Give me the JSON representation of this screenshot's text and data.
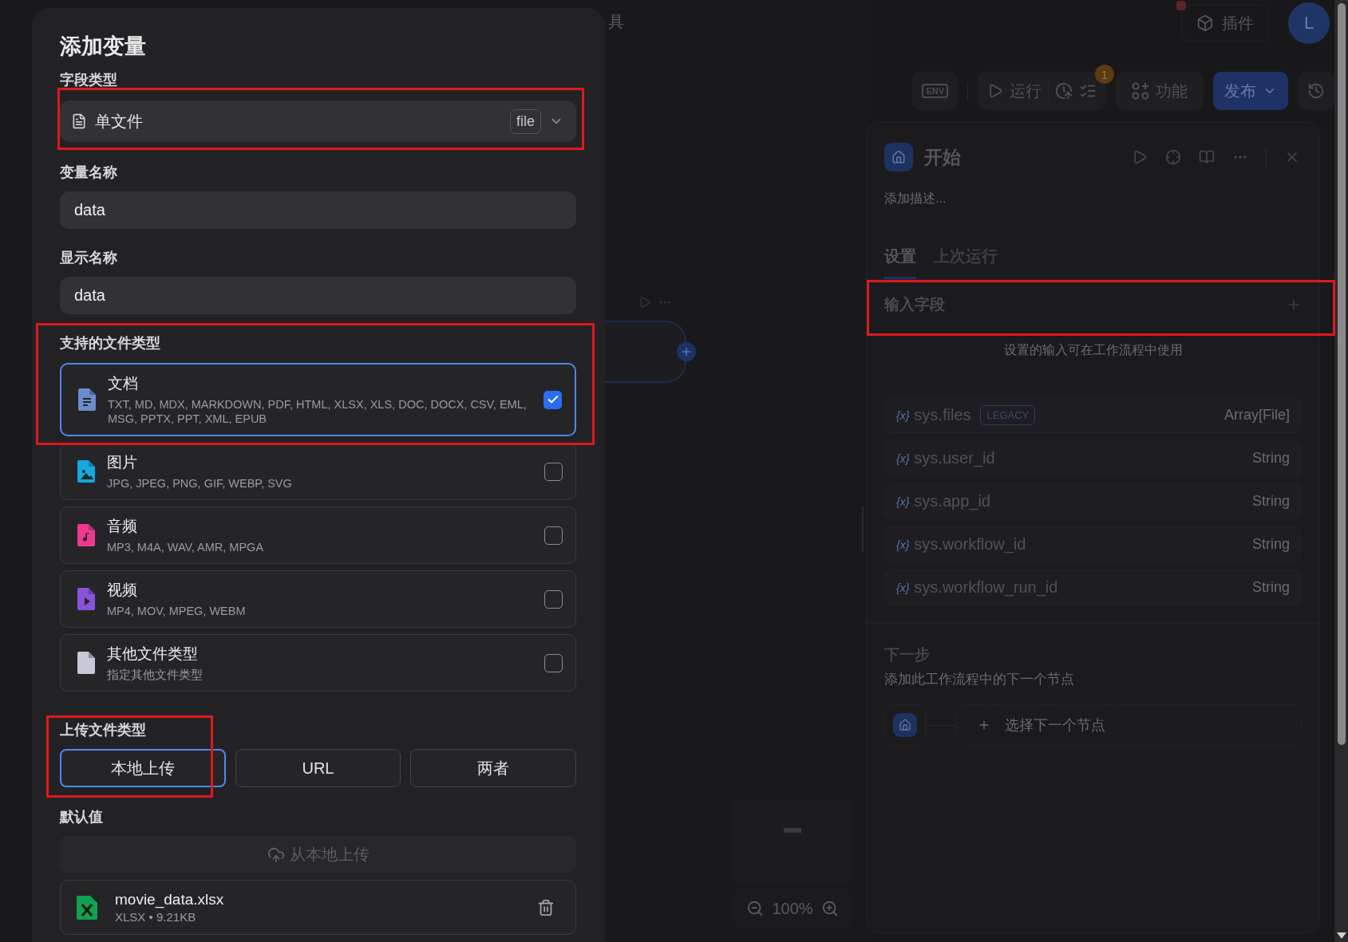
{
  "header": {
    "partial_title": "具",
    "plugins_button": "插件",
    "avatar": "L",
    "notification_dot": true
  },
  "toolbar": {
    "env": "ENV",
    "run": "运行",
    "checklist_badge": "1",
    "features": "功能",
    "publish": "发布"
  },
  "canvas": {
    "zoom": "100%"
  },
  "panel": {
    "title": "开始",
    "description_placeholder": "添加描述...",
    "tabs": [
      {
        "label": "设置",
        "selected": true
      },
      {
        "label": "上次运行",
        "selected": false
      }
    ],
    "input_fields": {
      "label": "输入字段",
      "highlighted": true,
      "empty_hint": "设置的输入可在工作流程中使用"
    },
    "variables": [
      {
        "icon": "{x}",
        "name": "sys.files",
        "badge": "LEGACY",
        "type": "Array[File]"
      },
      {
        "icon": "{x}",
        "name": "sys.user_id",
        "type": "String"
      },
      {
        "icon": "{x}",
        "name": "sys.app_id",
        "type": "String"
      },
      {
        "icon": "{x}",
        "name": "sys.workflow_id",
        "type": "String"
      },
      {
        "icon": "{x}",
        "name": "sys.workflow_run_id",
        "type": "String"
      }
    ],
    "next_step": {
      "title": "下一步",
      "description": "添加此工作流程中的下一个节点",
      "select_placeholder": "选择下一个节点"
    }
  },
  "modal": {
    "title": "添加变量",
    "field_type": {
      "label": "字段类型",
      "value": "单文件",
      "tag": "file",
      "highlighted": true
    },
    "variable_name": {
      "label": "变量名称",
      "value": "data"
    },
    "display_name": {
      "label": "显示名称",
      "value": "data"
    },
    "file_types": {
      "label": "支持的文件类型",
      "highlighted": true,
      "items": [
        {
          "kind": "document",
          "name": "文档",
          "extensions": "TXT, MD, MDX, MARKDOWN, PDF, HTML, XLSX, XLS, DOC, DOCX, CSV, EML, MSG, PPTX, PPT, XML, EPUB",
          "checked": true
        },
        {
          "kind": "image",
          "name": "图片",
          "extensions": "JPG, JPEG, PNG, GIF, WEBP, SVG",
          "checked": false
        },
        {
          "kind": "audio",
          "name": "音频",
          "extensions": "MP3, M4A, WAV, AMR, MPGA",
          "checked": false
        },
        {
          "kind": "video",
          "name": "视频",
          "extensions": "MP4, MOV, MPEG, WEBM",
          "checked": false
        },
        {
          "kind": "other",
          "name": "其他文件类型",
          "extensions": "指定其他文件类型",
          "checked": false
        }
      ]
    },
    "upload_type": {
      "label": "上传文件类型",
      "highlighted": true,
      "options": [
        {
          "label": "本地上传",
          "selected": true
        },
        {
          "label": "URL",
          "selected": false
        },
        {
          "label": "两者",
          "selected": false
        }
      ]
    },
    "default_value": {
      "label": "默认值",
      "upload_button": "从本地上传",
      "file": {
        "name": "movie_data.xlsx",
        "type": "XLSX",
        "separator": "•",
        "size": "9.21KB"
      }
    }
  }
}
